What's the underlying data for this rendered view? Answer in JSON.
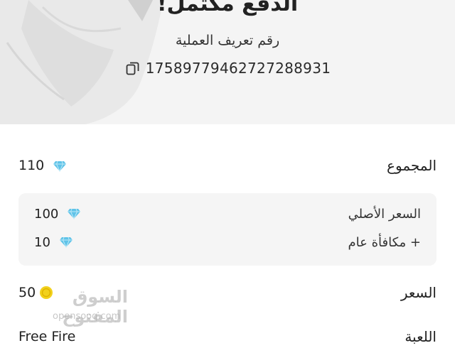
{
  "header": {
    "title": "الدفع مكتمل!",
    "transaction_label": "رقم تعريف العملية",
    "transaction_id": "17589779462727288931",
    "copy_icon": "copy-icon"
  },
  "summary": {
    "total_label": "المجموع",
    "total_value": "110",
    "currency_icon": "diamond-icon",
    "breakdown": [
      {
        "label": "السعر الأصلي",
        "value": "100"
      },
      {
        "label": "+ مكافأة عام",
        "value": "10"
      }
    ],
    "price_label": "السعر",
    "price_value": "50",
    "price_icon": "coin-icon",
    "game_label": "اللعبة",
    "game_value": "Free Fire"
  },
  "watermark": {
    "main": "السوق المفتوح",
    "sub": "opensooq.com"
  },
  "colors": {
    "header_bg": "#f4f4f4",
    "breakdown_bg": "#f5f5f5",
    "diamond": "#5fc3e8",
    "coin": "#f2d11c"
  }
}
